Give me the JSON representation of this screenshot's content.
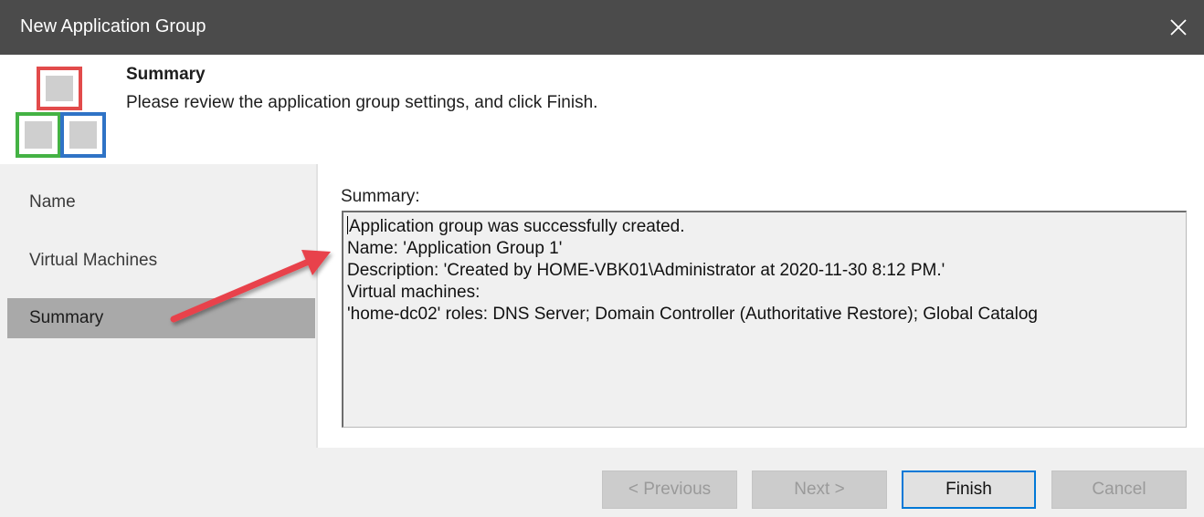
{
  "window": {
    "title": "New Application Group",
    "close_icon": "close-icon"
  },
  "header": {
    "title": "Summary",
    "subtitle": "Please review the application group settings, and click Finish.",
    "logo_icon": "application-group-icon",
    "logo_colors": {
      "top": "#e24b4b",
      "left": "#44b244",
      "right": "#2f73c6"
    }
  },
  "sidebar": {
    "items": [
      {
        "label": "Name",
        "selected": false
      },
      {
        "label": "Virtual Machines",
        "selected": false
      },
      {
        "label": "Summary",
        "selected": true
      }
    ]
  },
  "summary": {
    "label": "Summary:",
    "lines": [
      "Application group was successfully created.",
      "Name: 'Application Group 1'",
      "Description: 'Created by HOME-VBK01\\Administrator at 2020-11-30 8:12 PM.'",
      "Virtual machines:",
      "'home-dc02' roles: DNS Server; Domain Controller (Authoritative Restore); Global Catalog"
    ]
  },
  "annotation": {
    "icon": "red-arrow-annotation",
    "color": "#e8424b"
  },
  "footer": {
    "previous_label": "< Previous",
    "next_label": "Next >",
    "finish_label": "Finish",
    "cancel_label": "Cancel"
  },
  "colors": {
    "titlebar": "#4b4b4b",
    "selected": "#a9a9a9",
    "accent": "#0078d7"
  }
}
